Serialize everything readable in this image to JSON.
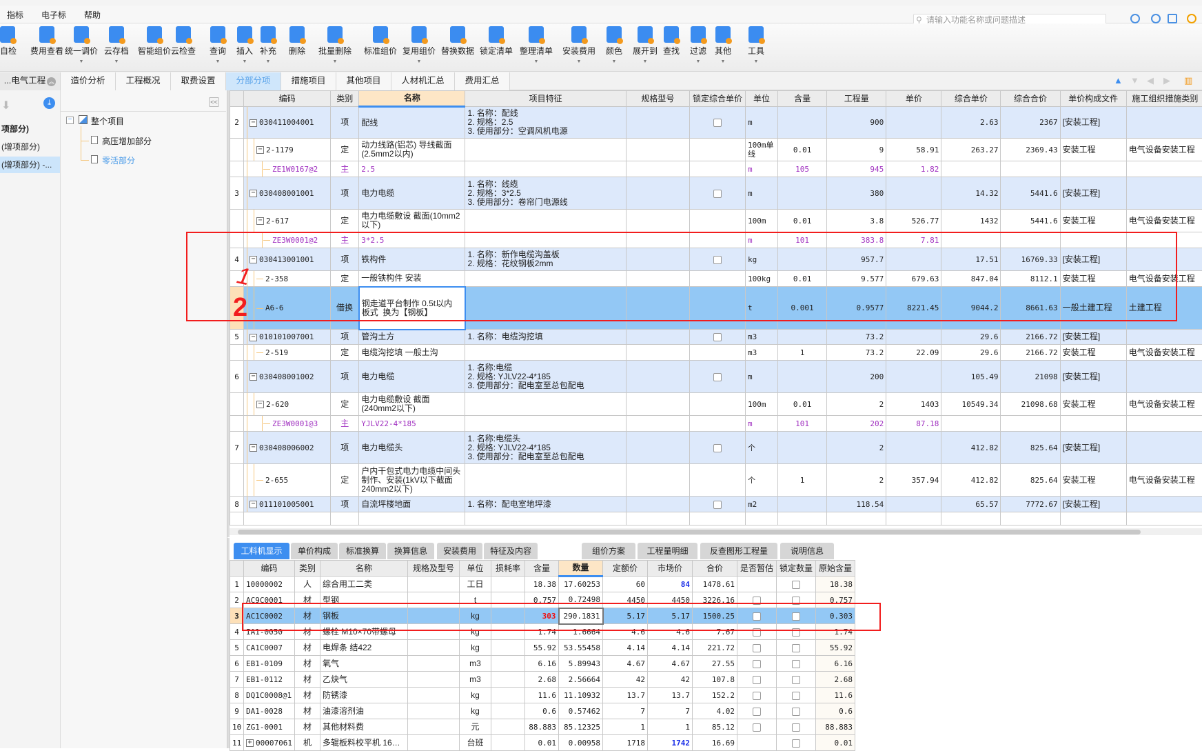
{
  "menu": {
    "items": [
      "指标",
      "电子标",
      "帮助"
    ],
    "search_placeholder": "请输入功能名称或问题描述"
  },
  "toolbar": {
    "buttons": [
      {
        "label": "自检",
        "icon": "self-check-icon"
      },
      {
        "label": "费用查看",
        "icon": "cost-view-icon"
      },
      {
        "label": "统一调价",
        "icon": "price-adjust-icon",
        "dropdown": true
      },
      {
        "label": "云存档",
        "icon": "cloud-upload-icon",
        "dropdown": true
      },
      {
        "label": "智能组价",
        "icon": "smart-pricing-icon"
      },
      {
        "label": "云检查",
        "icon": "cloud-check-icon"
      },
      {
        "label": "查询",
        "icon": "query-icon",
        "dropdown": true
      },
      {
        "label": "插入",
        "icon": "insert-icon",
        "dropdown": true
      },
      {
        "label": "补充",
        "icon": "supplement-icon",
        "dropdown": true
      },
      {
        "label": "删除",
        "icon": "trash-icon"
      },
      {
        "label": "批量删除",
        "icon": "batch-delete-icon",
        "dropdown": true
      },
      {
        "label": "标准组价",
        "icon": "standard-pricing-icon"
      },
      {
        "label": "复用组价",
        "icon": "reuse-pricing-icon",
        "dropdown": true
      },
      {
        "label": "替换数据",
        "icon": "replace-data-icon"
      },
      {
        "label": "锁定清单",
        "icon": "lock-icon"
      },
      {
        "label": "整理清单",
        "icon": "organize-list-icon",
        "dropdown": true
      },
      {
        "label": "安装费用",
        "icon": "install-cost-icon",
        "dropdown": true
      },
      {
        "label": "颜色",
        "icon": "color-bucket-icon",
        "dropdown": true
      },
      {
        "label": "展开到",
        "icon": "expand-to-icon",
        "dropdown": true
      },
      {
        "label": "查找",
        "icon": "binoculars-icon"
      },
      {
        "label": "过滤",
        "icon": "filter-icon",
        "dropdown": true
      },
      {
        "label": "其他",
        "icon": "other-grid-icon",
        "dropdown": true
      },
      {
        "label": "工具",
        "icon": "tools-icon",
        "dropdown": true
      }
    ]
  },
  "tabs": {
    "project": "...电气工程",
    "items": [
      "造价分析",
      "工程概况",
      "取费设置",
      "分部分项",
      "措施项目",
      "其他项目",
      "人材机汇总",
      "费用汇总"
    ],
    "active": "分部分项"
  },
  "left_panel": {
    "items": [
      "项部分)",
      "(增项部分)",
      "(增项部分) -..."
    ]
  },
  "tree": {
    "root": "整个项目",
    "children": [
      "高压增加部分",
      "零活部分"
    ]
  },
  "main_table": {
    "headers": [
      "",
      "编码",
      "类别",
      "名称",
      "项目特征",
      "规格型号",
      "锁定综合单价",
      "单位",
      "含量",
      "工程量",
      "单价",
      "综合单价",
      "综合合价",
      "单价构成文件",
      "施工组织措施类别"
    ],
    "rows": [
      {
        "no": "2",
        "code": "030411004001",
        "level": 0,
        "expander": "minus",
        "type": "项",
        "name": "配线",
        "feature": "1. 名称：配线\n2. 规格：2.5\n3. 使用部分：空调风机电源",
        "lock": false,
        "unit": "m",
        "content": "",
        "qty": "900",
        "price": "",
        "comp_price": "2.63",
        "comp_total": "2367",
        "price_file": "[安装工程]",
        "measure": "",
        "kind": "item"
      },
      {
        "no": "",
        "code": "2-1179",
        "level": 1,
        "expander": "minus",
        "type": "定",
        "name": "动力线路(铝芯) 导线截面(2.5mm2以内)",
        "feature": "",
        "unit": "100m单线",
        "content": "0.01",
        "qty": "9",
        "price": "58.91",
        "comp_price": "263.27",
        "comp_total": "2369.43",
        "price_file": "安装工程",
        "measure": "电气设备安装工程",
        "kind": "quota"
      },
      {
        "no": "",
        "code": "ZE1W0167@2",
        "level": 2,
        "type": "主",
        "name": "2.5",
        "feature": "",
        "unit": "m",
        "content": "105",
        "qty": "945",
        "price": "1.82",
        "comp_price": "",
        "comp_total": "",
        "price_file": "",
        "measure": "",
        "kind": "main"
      },
      {
        "no": "3",
        "code": "030408001001",
        "level": 0,
        "expander": "minus",
        "type": "项",
        "name": "电力电缆",
        "feature": "1. 名称：线缆\n2. 规格：3*2.5\n3. 使用部分：卷帘门电源线",
        "lock": false,
        "unit": "m",
        "content": "",
        "qty": "380",
        "price": "",
        "comp_price": "14.32",
        "comp_total": "5441.6",
        "price_file": "[安装工程]",
        "measure": "",
        "kind": "item"
      },
      {
        "no": "",
        "code": "2-617",
        "level": 1,
        "expander": "minus",
        "type": "定",
        "name": "电力电缆敷设 截面(10mm2以下)",
        "feature": "",
        "unit": "100m",
        "content": "0.01",
        "qty": "3.8",
        "price": "526.77",
        "comp_price": "1432",
        "comp_total": "5441.6",
        "price_file": "安装工程",
        "measure": "电气设备安装工程",
        "kind": "quota"
      },
      {
        "no": "",
        "code": "ZE3W0001@2",
        "level": 2,
        "type": "主",
        "name": "3*2.5",
        "feature": "",
        "unit": "m",
        "content": "101",
        "qty": "383.8",
        "price": "7.81",
        "comp_price": "",
        "comp_total": "",
        "price_file": "",
        "measure": "",
        "kind": "main"
      },
      {
        "no": "4",
        "code": "030413001001",
        "level": 0,
        "expander": "minus",
        "type": "项",
        "name": "铁构件",
        "feature": "1. 名称：新作电缆沟盖板\n2. 规格：花纹钢板2mm",
        "lock": false,
        "unit": "kg",
        "content": "",
        "qty": "957.7",
        "price": "",
        "comp_price": "17.51",
        "comp_total": "16769.33",
        "price_file": "[安装工程]",
        "measure": "",
        "kind": "item"
      },
      {
        "no": "",
        "code": "2-358",
        "level": 1,
        "type": "定",
        "name": "一般铁构件 安装",
        "feature": "",
        "unit": "100kg",
        "content": "0.01",
        "qty": "9.577",
        "price": "679.63",
        "comp_price": "847.04",
        "comp_total": "8112.1",
        "price_file": "安装工程",
        "measure": "电气设备安装工程",
        "kind": "quota"
      },
      {
        "no": "",
        "code": "A6-6",
        "level": 1,
        "type": "借换",
        "name": "钢走道平台制作 0.5t以内 板式  换为【钢板】",
        "feature": "",
        "unit": "t",
        "content": "0.001",
        "qty": "0.9577",
        "price": "8221.45",
        "comp_price": "9044.2",
        "comp_total": "8661.63",
        "price_file": "一般土建工程",
        "measure": "土建工程",
        "kind": "sel"
      },
      {
        "no": "5",
        "code": "010101007001",
        "level": 0,
        "expander": "minus",
        "type": "项",
        "name": "管沟土方",
        "feature": "1. 名称：电缆沟挖填",
        "lock": false,
        "unit": "m3",
        "content": "",
        "qty": "73.2",
        "price": "",
        "comp_price": "29.6",
        "comp_total": "2166.72",
        "price_file": "[安装工程]",
        "measure": "",
        "kind": "item"
      },
      {
        "no": "",
        "code": "2-519",
        "level": 1,
        "type": "定",
        "name": "电缆沟挖填 一般土沟",
        "feature": "",
        "unit": "m3",
        "content": "1",
        "qty": "73.2",
        "price": "22.09",
        "comp_price": "29.6",
        "comp_total": "2166.72",
        "price_file": "安装工程",
        "measure": "电气设备安装工程",
        "kind": "quota"
      },
      {
        "no": "6",
        "code": "030408001002",
        "level": 0,
        "expander": "minus",
        "type": "项",
        "name": "电力电缆",
        "feature": "1. 名称:电缆\n2. 规格: YJLV22-4*185\n3. 使用部分：配电室至总包配电",
        "lock": false,
        "unit": "m",
        "content": "",
        "qty": "200",
        "price": "",
        "comp_price": "105.49",
        "comp_total": "21098",
        "price_file": "[安装工程]",
        "measure": "",
        "kind": "item"
      },
      {
        "no": "",
        "code": "2-620",
        "level": 1,
        "expander": "minus",
        "type": "定",
        "name": "电力电缆敷设 截面(240mm2以下)",
        "feature": "",
        "unit": "100m",
        "content": "0.01",
        "qty": "2",
        "price": "1403",
        "comp_price": "10549.34",
        "comp_total": "21098.68",
        "price_file": "安装工程",
        "measure": "电气设备安装工程",
        "kind": "quota"
      },
      {
        "no": "",
        "code": "ZE3W0001@3",
        "level": 2,
        "type": "主",
        "name": "YJLV22-4*185",
        "feature": "",
        "unit": "m",
        "content": "101",
        "qty": "202",
        "price": "87.18",
        "comp_price": "",
        "comp_total": "",
        "price_file": "",
        "measure": "",
        "kind": "main"
      },
      {
        "no": "7",
        "code": "030408006002",
        "level": 0,
        "expander": "minus",
        "type": "项",
        "name": "电力电缆头",
        "feature": "1. 名称:电缆头\n2. 规格: YJLV22-4*185\n3. 使用部分：配电室至总包配电",
        "lock": false,
        "unit": "个",
        "content": "",
        "qty": "2",
        "price": "",
        "comp_price": "412.82",
        "comp_total": "825.64",
        "price_file": "[安装工程]",
        "measure": "",
        "kind": "item"
      },
      {
        "no": "",
        "code": "2-655",
        "level": 1,
        "type": "定",
        "name": "户内干包式电力电缆中间头制作、安装(1kV以下截面240mm2以下)",
        "feature": "",
        "unit": "个",
        "content": "1",
        "qty": "2",
        "price": "357.94",
        "comp_price": "412.82",
        "comp_total": "825.64",
        "price_file": "安装工程",
        "measure": "电气设备安装工程",
        "kind": "quota"
      },
      {
        "no": "8",
        "code": "011101005001",
        "level": 0,
        "expander": "minus",
        "type": "项",
        "name": "自流坪楼地面",
        "feature": "1. 名称：配电室地坪漆",
        "lock": false,
        "unit": "m2",
        "content": "",
        "qty": "118.54",
        "price": "",
        "comp_price": "65.57",
        "comp_total": "7772.67",
        "price_file": "[安装工程]",
        "measure": "",
        "kind": "item"
      }
    ]
  },
  "bottom_tabs": {
    "items": [
      "工料机显示",
      "单价构成",
      "标准换算",
      "换算信息",
      "安装费用",
      "特征及内容",
      "组价方案",
      "工程量明细",
      "反查图形工程量",
      "说明信息"
    ],
    "active": "工料机显示"
  },
  "material_table": {
    "headers": [
      "",
      "编码",
      "类别",
      "名称",
      "规格及型号",
      "单位",
      "损耗率",
      "含量",
      "数量",
      "定额价",
      "市场价",
      "合价",
      "是否暂估",
      "锁定数量",
      "原始含量"
    ],
    "rows": [
      {
        "no": "1",
        "code": "10000002",
        "type": "人",
        "name": "综合用工二类",
        "spec": "",
        "unit": "工日",
        "loss": "",
        "content": "18.38",
        "qty": "17.60253",
        "quota_price": "60",
        "market_price": "84",
        "market_hl": true,
        "total": "1478.61",
        "provisional": null,
        "lock_qty": false,
        "orig": "18.38"
      },
      {
        "no": "2",
        "code": "AC9C0001",
        "type": "材",
        "name": "型钢",
        "spec": "",
        "unit": "t",
        "loss": "",
        "content": "0.757",
        "qty": "0.72498",
        "quota_price": "4450",
        "market_price": "4450",
        "total": "3226.16",
        "provisional": false,
        "lock_qty": false,
        "orig": "0.757"
      },
      {
        "no": "3",
        "code": "AC1C0002",
        "type": "材",
        "name": "钢板",
        "spec": "",
        "unit": "kg",
        "loss": "",
        "content": "303",
        "content_hl": true,
        "qty": "290.1831",
        "quota_price": "5.17",
        "market_price": "5.17",
        "total": "1500.25",
        "provisional": false,
        "lock_qty": false,
        "orig": "0.303",
        "selected": true
      },
      {
        "no": "4",
        "code": "IA1-0050",
        "type": "材",
        "name": "螺栓 M10×70带螺母",
        "spec": "",
        "unit": "kg",
        "loss": "",
        "content": "1.74",
        "qty": "1.6664",
        "quota_price": "4.6",
        "market_price": "4.6",
        "total": "7.67",
        "provisional": false,
        "lock_qty": false,
        "orig": "1.74"
      },
      {
        "no": "5",
        "code": "CA1C0007",
        "type": "材",
        "name": "电焊条 结422",
        "spec": "",
        "unit": "kg",
        "loss": "",
        "content": "55.92",
        "qty": "53.55458",
        "quota_price": "4.14",
        "market_price": "4.14",
        "total": "221.72",
        "provisional": false,
        "lock_qty": false,
        "orig": "55.92"
      },
      {
        "no": "6",
        "code": "EB1-0109",
        "type": "材",
        "name": "氧气",
        "spec": "",
        "unit": "m3",
        "loss": "",
        "content": "6.16",
        "qty": "5.89943",
        "quota_price": "4.67",
        "market_price": "4.67",
        "total": "27.55",
        "provisional": false,
        "lock_qty": false,
        "orig": "6.16"
      },
      {
        "no": "7",
        "code": "EB1-0112",
        "type": "材",
        "name": "乙炔气",
        "spec": "",
        "unit": "m3",
        "loss": "",
        "content": "2.68",
        "qty": "2.56664",
        "quota_price": "42",
        "market_price": "42",
        "total": "107.8",
        "provisional": false,
        "lock_qty": false,
        "orig": "2.68"
      },
      {
        "no": "8",
        "code": "DQ1C0008@1",
        "type": "材",
        "name": "防锈漆",
        "spec": "",
        "unit": "kg",
        "loss": "",
        "content": "11.6",
        "qty": "11.10932",
        "quota_price": "13.7",
        "market_price": "13.7",
        "total": "152.2",
        "provisional": false,
        "lock_qty": false,
        "orig": "11.6"
      },
      {
        "no": "9",
        "code": "DA1-0028",
        "type": "材",
        "name": "油漆溶剂油",
        "spec": "",
        "unit": "kg",
        "loss": "",
        "content": "0.6",
        "qty": "0.57462",
        "quota_price": "7",
        "market_price": "7",
        "total": "4.02",
        "provisional": false,
        "lock_qty": false,
        "orig": "0.6"
      },
      {
        "no": "10",
        "code": "ZG1-0001",
        "type": "材",
        "name": "其他材料费",
        "spec": "",
        "unit": "元",
        "loss": "",
        "content": "88.883",
        "qty": "85.12325",
        "quota_price": "1",
        "market_price": "1",
        "total": "85.12",
        "provisional": false,
        "lock_qty": false,
        "orig": "88.883"
      },
      {
        "no": "11",
        "code": "00007061",
        "expander": "plus",
        "type": "机",
        "name": "多辊板料校平机 16…",
        "spec": "",
        "unit": "台班",
        "loss": "",
        "content": "0.01",
        "qty": "0.00958",
        "quota_price": "1718",
        "market_price": "1742",
        "market_hl": true,
        "total": "16.69",
        "provisional": null,
        "lock_qty": false,
        "orig": "0.01"
      }
    ]
  },
  "annotations": {
    "marks": [
      "1",
      "2"
    ]
  },
  "colors": {
    "accent": "#3d8ef0",
    "selected_row": "#93c8f5",
    "item_row": "#dde9fb",
    "main_material": "#a030c0",
    "annotation": "#f21d1d"
  }
}
